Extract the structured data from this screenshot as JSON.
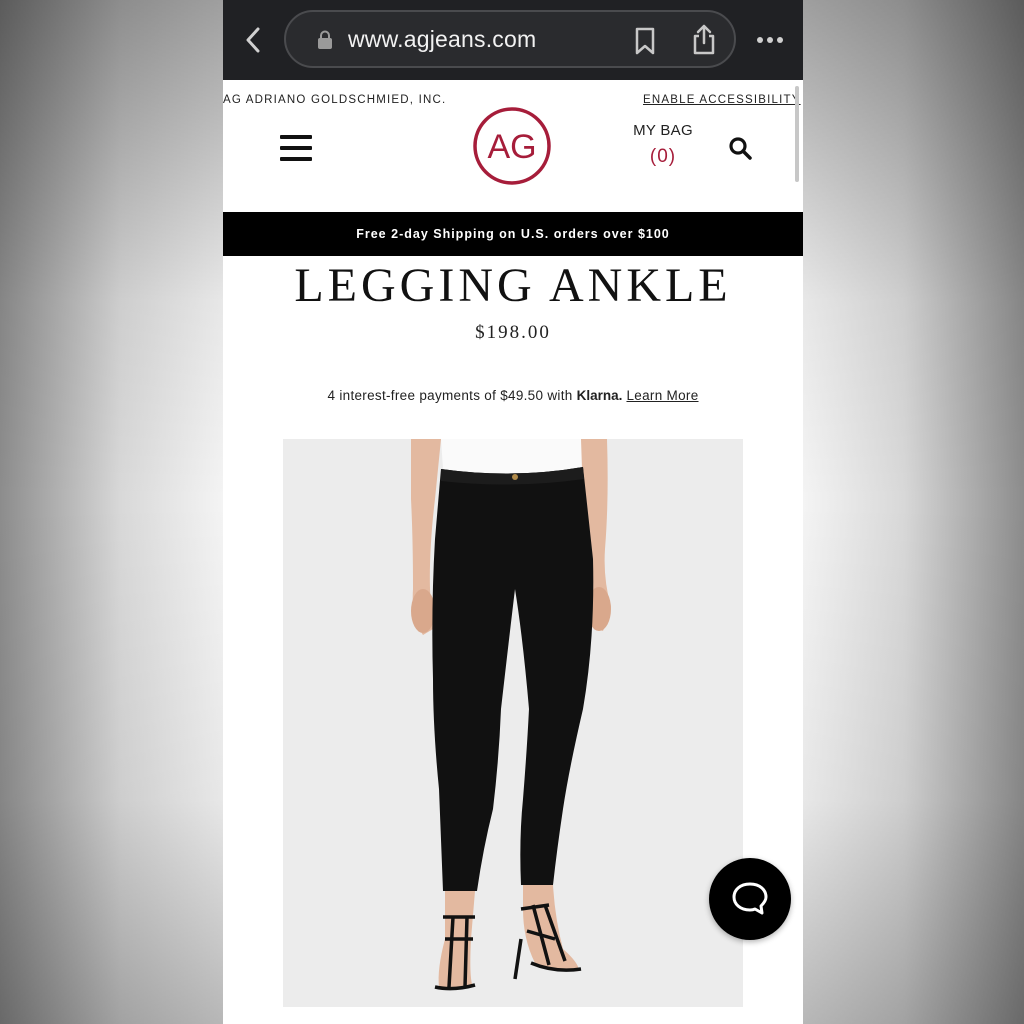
{
  "browser": {
    "url": "www.agjeans.com",
    "icons": [
      "back-icon",
      "lock-icon",
      "bookmark-icon",
      "share-icon",
      "more-icon"
    ]
  },
  "header": {
    "company": "AG ADRIANO GOLDSCHMIED, INC.",
    "accessibility_link": "ENABLE ACCESSIBILITY",
    "logo_text": "AG",
    "bag_label": "MY BAG",
    "bag_count": "(0)",
    "brand_color": "#a61d3a"
  },
  "promo": {
    "text": "Free 2-day Shipping on U.S. orders over $100"
  },
  "product": {
    "title": "LEGGING ANKLE",
    "price": "$198.00",
    "klarna_text": "4 interest-free payments of $49.50 with",
    "klarna_brand": "Klarna.",
    "learn_more": "Learn More"
  },
  "chat": {
    "icon": "chat-bubble-icon"
  }
}
